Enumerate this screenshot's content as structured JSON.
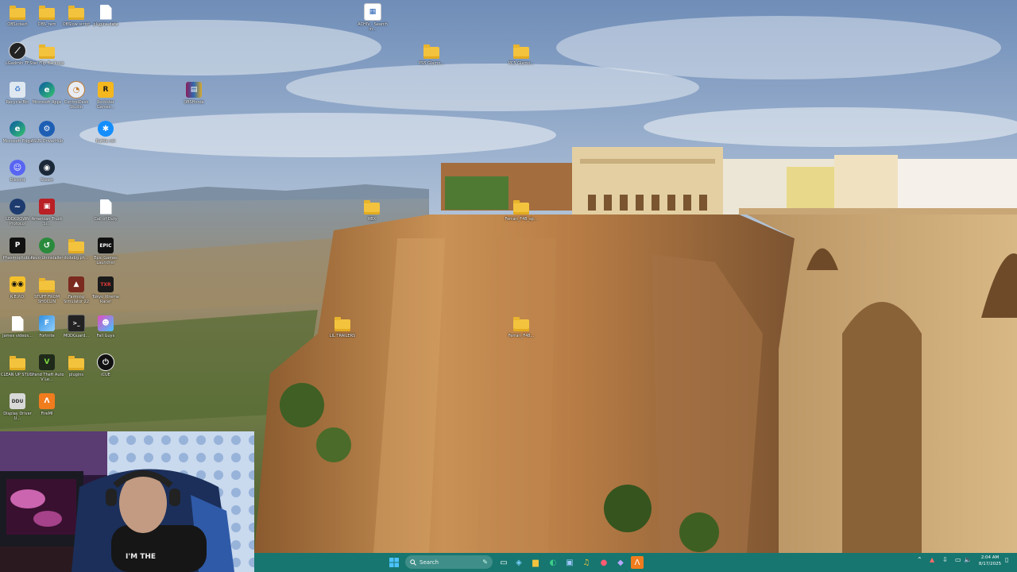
{
  "desktop": {
    "icons": [
      {
        "label": "OBSxdash",
        "type": "folder"
      },
      {
        "label": "OBS_ram",
        "type": "folder"
      },
      {
        "label": "OBSlow script",
        "type": "folder"
      },
      {
        "label": "plugins-data",
        "type": "file"
      },
      {
        "label": "LGadmin TF",
        "type": "app"
      },
      {
        "label": "Star Flip Backups",
        "type": "folder"
      },
      {
        "label": "Recycle Bin",
        "type": "recycle"
      },
      {
        "label": "Microsoft Apps",
        "type": "edge"
      },
      {
        "label": "ControlDesk Studio",
        "type": "app"
      },
      {
        "label": "Rockstar Games...",
        "type": "rockstar"
      },
      {
        "label": "Microsoft Edge",
        "type": "edge"
      },
      {
        "label": "ASUS DriverHub",
        "type": "gear"
      },
      {
        "label": "Battle.net",
        "type": "battlenet"
      },
      {
        "label": "Discord",
        "type": "discord"
      },
      {
        "label": "Steam",
        "type": "steam"
      },
      {
        "label": "LOCKDOWN Protocol",
        "type": "app"
      },
      {
        "label": "American Truck Si...",
        "type": "truck"
      },
      {
        "label": "Call of Duty",
        "type": "file"
      },
      {
        "label": "Phasmophobia",
        "type": "app"
      },
      {
        "label": "Revo Uninstaller",
        "type": "revo"
      },
      {
        "label": "dcdebg.ph...",
        "type": "folder"
      },
      {
        "label": "Epic Games Launcher",
        "type": "epic"
      },
      {
        "label": "R.E.P.O.",
        "type": "repo"
      },
      {
        "label": "STUFF FROM SHOCLIN",
        "type": "folder"
      },
      {
        "label": "Farming Simulator 22",
        "type": "farming"
      },
      {
        "label": "Tokyo Xtreme Racer",
        "type": "tokyo"
      },
      {
        "label": "James videos...",
        "type": "file"
      },
      {
        "label": "Fortnite",
        "type": "fortnite"
      },
      {
        "label": "MODGuard...",
        "type": "terminal"
      },
      {
        "label": "Fall Guys",
        "type": "fallguys"
      },
      {
        "label": "CLEAN UP STUFF",
        "type": "folder"
      },
      {
        "label": "Grand Theft Auto V Le...",
        "type": "gta"
      },
      {
        "label": "plugins",
        "type": "folder"
      },
      {
        "label": "iCUE",
        "type": "icue"
      },
      {
        "label": "Display Driver U...",
        "type": "ddu"
      },
      {
        "label": "FireMI",
        "type": "firemi"
      },
      {
        "label": "OBSHorde",
        "type": "winrar"
      },
      {
        "label": "ACHIV - Search in...",
        "type": "doc"
      },
      {
        "label": "PS5 Glamo...",
        "type": "folder"
      },
      {
        "label": "PC5 Glamo...",
        "type": "folder"
      },
      {
        "label": "RBX",
        "type": "folder"
      },
      {
        "label": "Ferrari_F48_sp...",
        "type": "folder"
      },
      {
        "label": "LIL TRAILERS",
        "type": "folder"
      },
      {
        "label": "Ferrari_F48...",
        "type": "folder"
      }
    ]
  },
  "taskbar": {
    "search_label": "Search",
    "apps": [
      "widgets",
      "copilot",
      "task-view",
      "file-explorer",
      "edge",
      "store",
      "music",
      "teams",
      "firemi"
    ],
    "tray": {
      "time": "2:04 AM",
      "date": "8/17/2025"
    }
  },
  "colors": {
    "taskbar": "#17766f",
    "folder": "#f3c33e"
  }
}
